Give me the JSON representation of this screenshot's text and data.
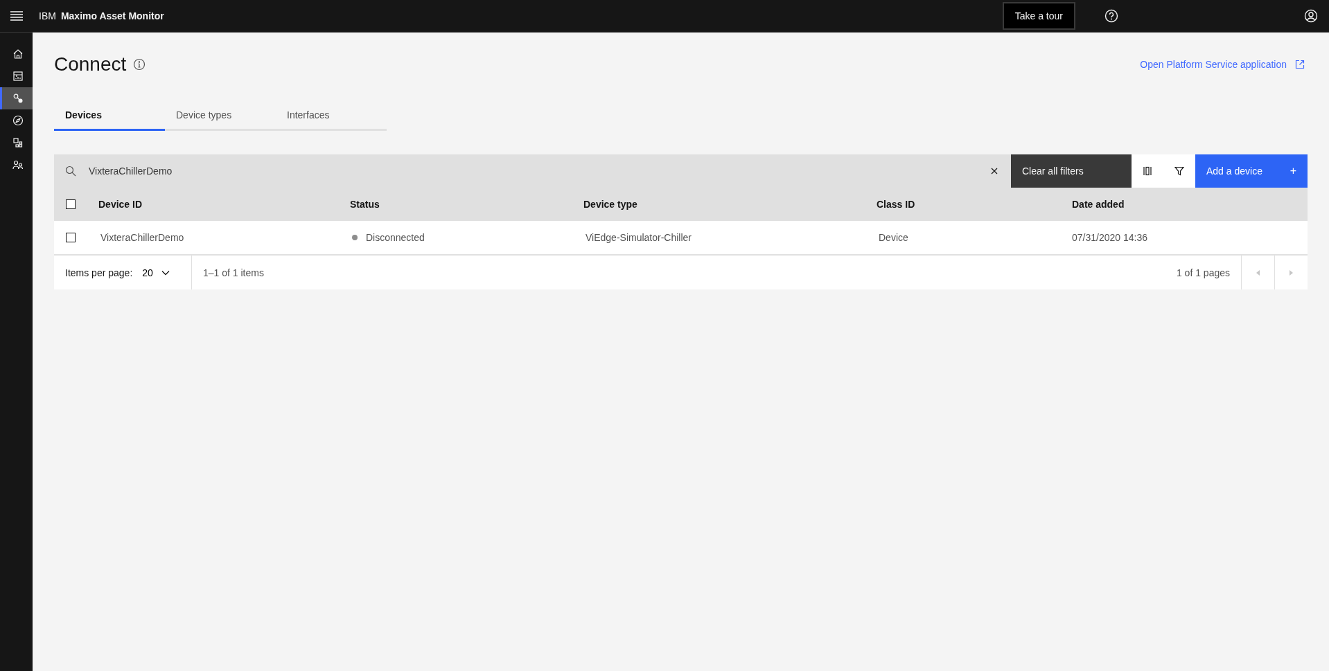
{
  "header": {
    "brand": "IBM",
    "product": "Maximo Asset Monitor",
    "tour_button": "Take a tour"
  },
  "sidebar": {
    "items": [
      {
        "kind": "home",
        "selected": false
      },
      {
        "kind": "dashboard",
        "selected": false
      },
      {
        "kind": "connect",
        "selected": true
      },
      {
        "kind": "compass",
        "selected": false
      },
      {
        "kind": "apps",
        "selected": false
      },
      {
        "kind": "people",
        "selected": false
      }
    ]
  },
  "page": {
    "title": "Connect",
    "link": "Open Platform Service application"
  },
  "tabs": [
    {
      "label": "Devices",
      "selected": true
    },
    {
      "label": "Device types",
      "selected": false
    },
    {
      "label": "Interfaces",
      "selected": false
    }
  ],
  "toolbar": {
    "search_value": "VixteraChillerDemo",
    "clear_button": "Clear all filters",
    "add_button": "Add a device",
    "add_glyph": "+"
  },
  "table": {
    "select_all_checked": false,
    "columns": [
      "Device ID",
      "Status",
      "Device type",
      "Class ID",
      "Date added"
    ],
    "rows": [
      {
        "checked": false,
        "device_id": "VixteraChillerDemo",
        "status": "Disconnected",
        "color": "#8d8d8d",
        "device_type": "ViEdge-Simulator-Chiller",
        "class_id": "Device",
        "date_added": "07/31/2020 14:36"
      }
    ]
  },
  "pagination": {
    "items_per_page_label": "Items per page:",
    "page_size": "20",
    "range": "1–1 of 1 items",
    "pages": "1 of 1 pages",
    "previous_disabled": true,
    "next_disabled": true
  }
}
